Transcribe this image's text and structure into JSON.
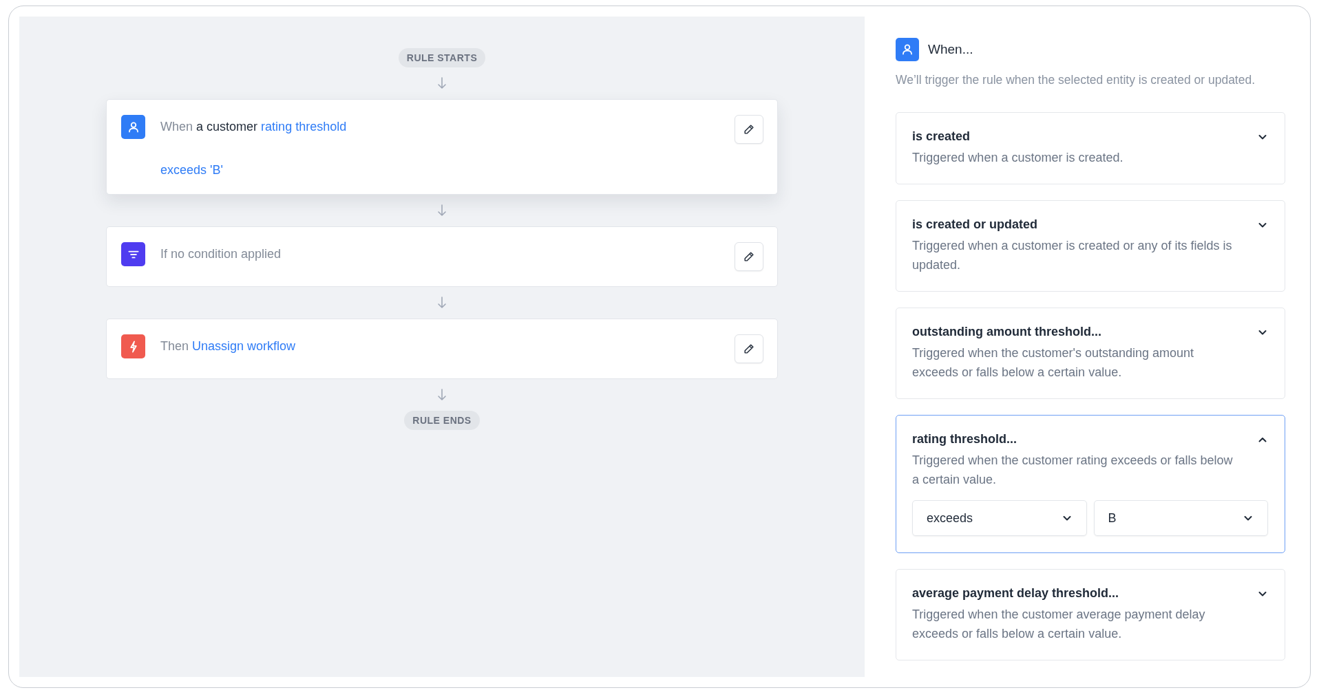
{
  "flow": {
    "start_label": "RULE STARTS",
    "end_label": "RULE ENDS",
    "steps": [
      {
        "kind": "trigger",
        "highlighted": true,
        "segments": [
          {
            "text": "When",
            "kind": "plain"
          },
          {
            "text": "a customer",
            "kind": "entity"
          },
          {
            "text": "rating threshold",
            "kind": "link"
          }
        ],
        "detail": "exceeds 'B'"
      },
      {
        "kind": "condition",
        "highlighted": false,
        "segments": [
          {
            "text": "If no condition applied",
            "kind": "plain"
          }
        ]
      },
      {
        "kind": "action",
        "highlighted": false,
        "segments": [
          {
            "text": "Then",
            "kind": "plain"
          },
          {
            "text": "Unassign workflow",
            "kind": "link"
          }
        ]
      }
    ]
  },
  "panel": {
    "title": "When...",
    "subtitle": "We’ll trigger the rule when the selected entity is created or updated.",
    "options": [
      {
        "title": "is created",
        "description": "Triggered when a customer is created.",
        "expanded": false,
        "selected": false
      },
      {
        "title": "is created or updated",
        "description": "Triggered when a customer is created or any of its fields is updated.",
        "expanded": false,
        "selected": false
      },
      {
        "title": "outstanding amount threshold...",
        "description": "Triggered when the customer's outstanding amount exceeds or falls below a certain value.",
        "expanded": false,
        "selected": false
      },
      {
        "title": "rating threshold...",
        "description": "Triggered when the customer rating exceeds or falls below a certain value.",
        "expanded": true,
        "selected": true,
        "selects": [
          {
            "value": "exceeds"
          },
          {
            "value": "B"
          }
        ]
      },
      {
        "title": "average payment delay threshold...",
        "description": "Triggered when the customer average payment delay exceeds or falls below a certain value.",
        "expanded": false,
        "selected": false
      }
    ]
  }
}
